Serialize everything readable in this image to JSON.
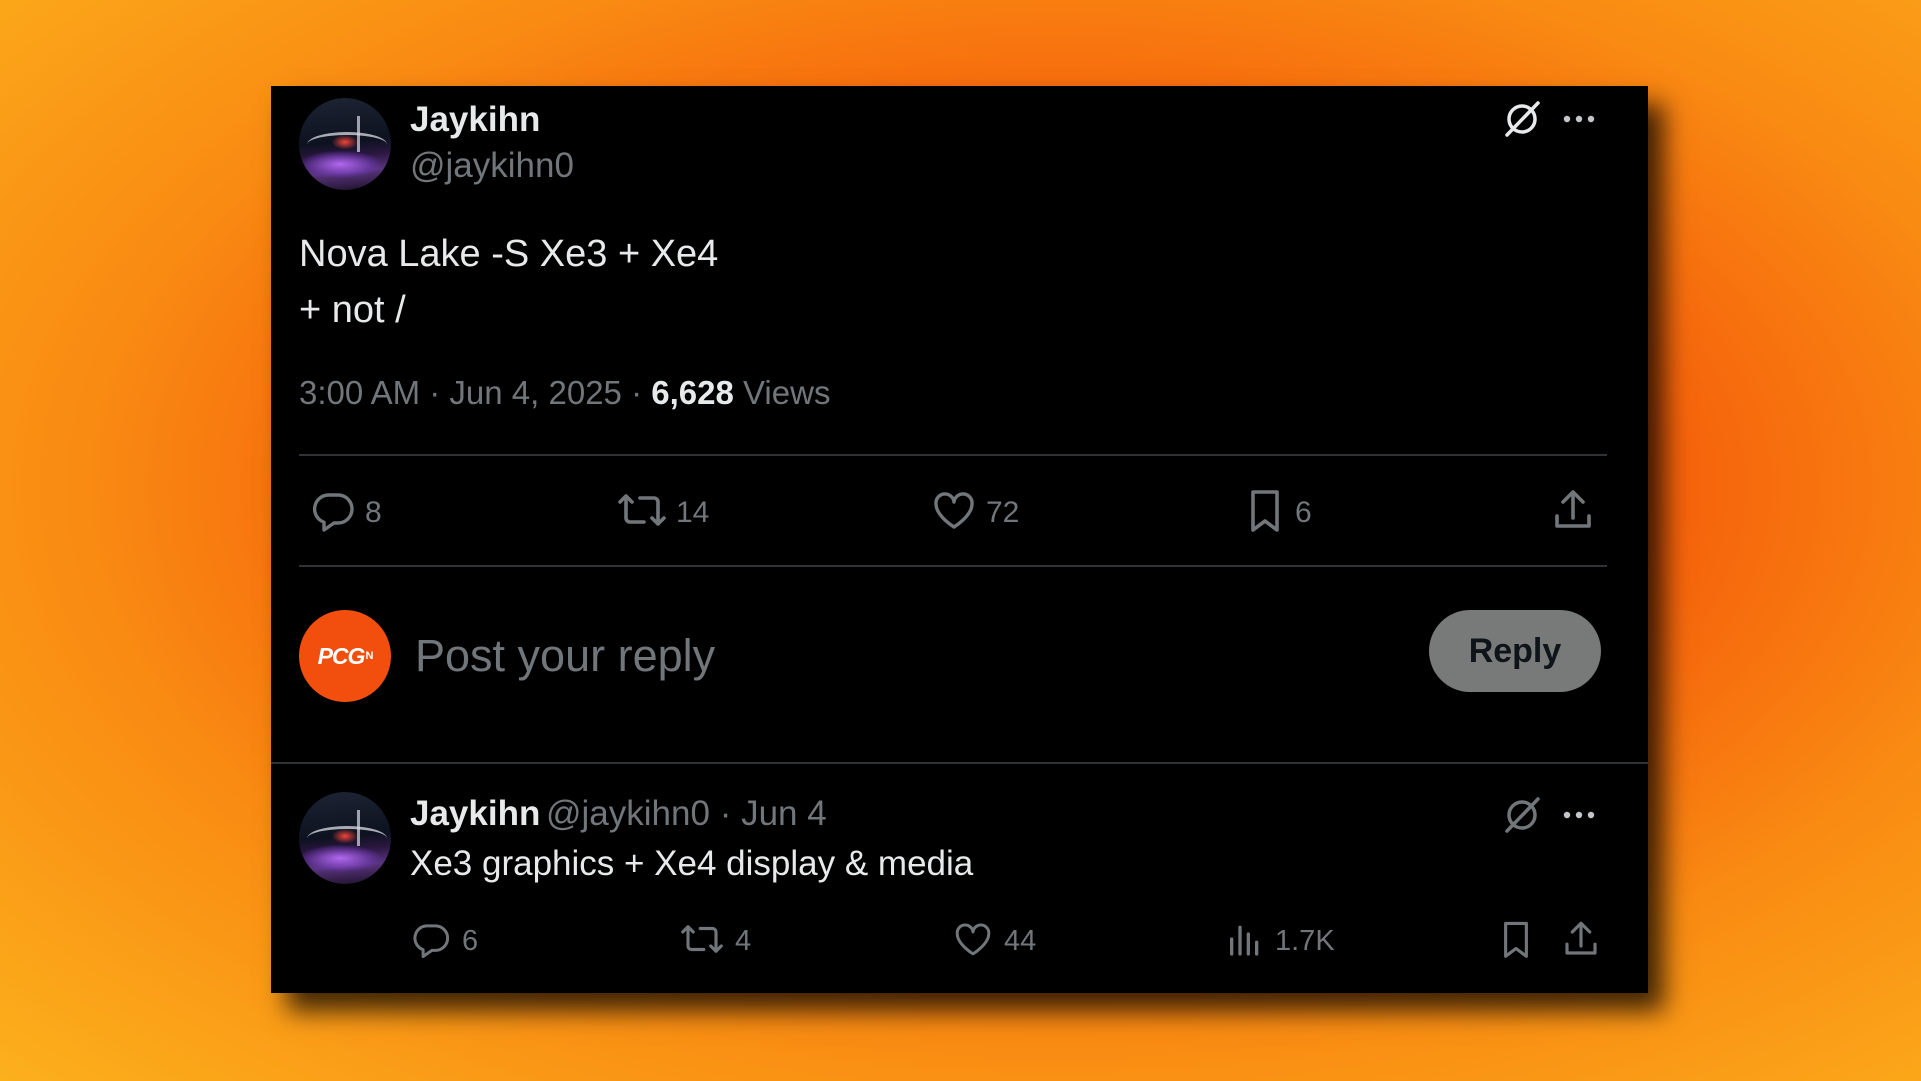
{
  "main_post": {
    "author_name": "Jaykihn",
    "author_handle": "@jaykihn0",
    "text_line1": "Nova Lake -S Xe3 + Xe4",
    "text_line2": "+ not /",
    "time": "3:00 AM",
    "date": "Jun 4, 2025",
    "views_count": "6,628",
    "views_label": "Views",
    "replies": "8",
    "reposts": "14",
    "likes": "72",
    "bookmarks": "6"
  },
  "reply_box": {
    "avatar_text": "PCG",
    "avatar_sup": "N",
    "placeholder": "Post your reply",
    "button_label": "Reply"
  },
  "reply_post": {
    "author_name": "Jaykihn",
    "author_handle": "@jaykihn0",
    "date": "· Jun 4",
    "text": "Xe3 graphics + Xe4 display & media",
    "replies": "6",
    "reposts": "4",
    "likes": "44",
    "views": "1.7K"
  },
  "colors": {
    "background_orange": "#f23d06",
    "background_yellow": "#fcb01c",
    "card": "#000000",
    "text_primary": "#e7e9ea",
    "text_secondary": "#71767b",
    "reply_button": "#787a7a",
    "pcgn_avatar": "#f24f0e"
  },
  "icons": [
    "grok-icon",
    "more-icon",
    "reply-icon",
    "repost-icon",
    "like-icon",
    "bookmark-icon",
    "share-icon",
    "views-icon"
  ]
}
